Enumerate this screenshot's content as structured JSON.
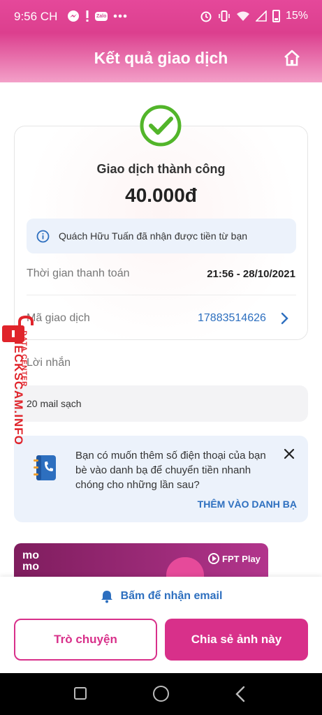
{
  "status_bar": {
    "time": "9:56 CH",
    "zalo": "Zalo",
    "battery": "15%"
  },
  "header": {
    "title": "Kết quả giao dịch"
  },
  "result": {
    "status": "Giao dịch thành công",
    "amount": "40.000đ",
    "info": "Quách Hữu Tuấn đã nhận được tiền từ bạn",
    "payment_time_label": "Thời gian thanh toán",
    "payment_time_value": "21:56 - 28/10/2021",
    "txn_id_label": "Mã giao dịch",
    "txn_id_value": "17883514626"
  },
  "message": {
    "label": "Lời nhắn",
    "text": "20 mail sạch"
  },
  "suggestion": {
    "text": "Bạn có muốn thêm số điện thoại của bạn bè vào danh bạ để chuyển tiền nhanh chóng cho những lần sau?",
    "action": "THÊM VÀO DANH BẠ"
  },
  "banner": {
    "momo": "mo mo",
    "partner": "FPT Play"
  },
  "bottom": {
    "email_prompt": "Bấm để nhận email",
    "chat_button": "Trò chuyện",
    "share_button": "Chia sẻ ảnh này"
  },
  "watermark": {
    "main": "CHECKSCAM.INFO",
    "sub": "DATA CENTER"
  },
  "colors": {
    "brand": "#d8308a",
    "link": "#2d6fbf",
    "success": "#52b52a",
    "info_bg": "#ecf2fb"
  },
  "icons": [
    "messenger-icon",
    "alert-icon",
    "zalo-icon",
    "more-icon",
    "alarm-icon",
    "vibrate-icon",
    "wifi-icon",
    "signal-icon",
    "battery-icon",
    "home-icon",
    "check-icon",
    "info-icon",
    "chevron-right-icon",
    "contact-book-icon",
    "close-icon",
    "bell-icon",
    "lock-icon"
  ]
}
